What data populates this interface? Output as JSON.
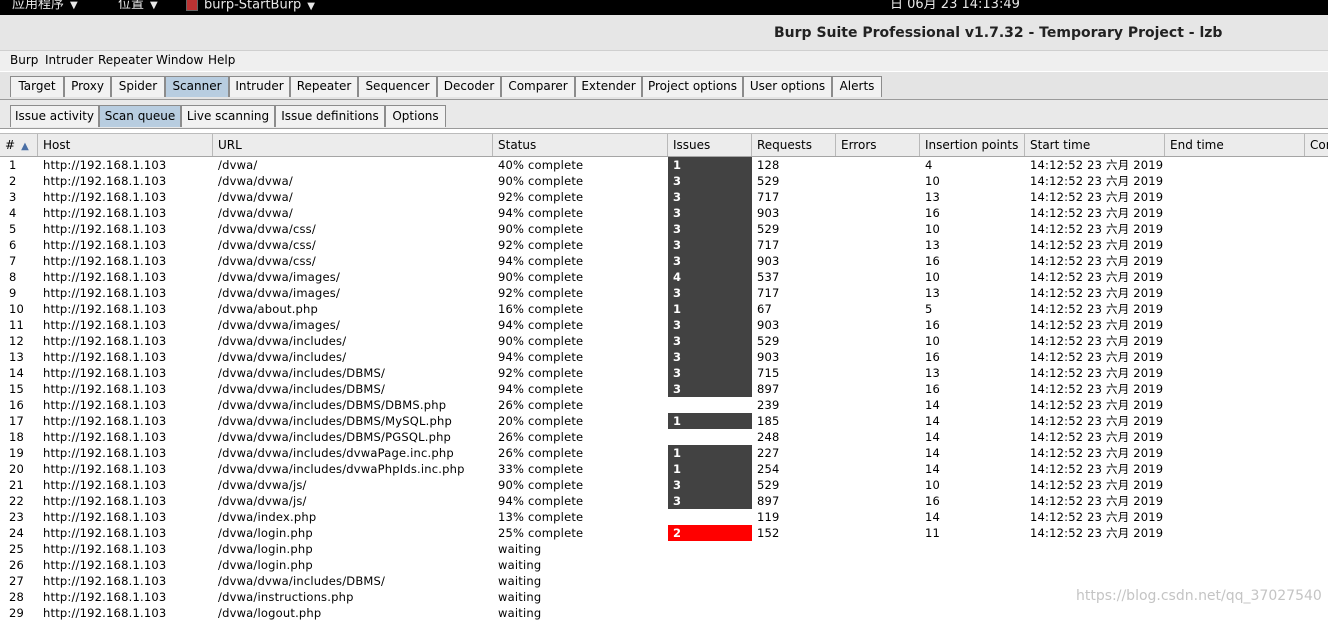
{
  "system_bar": {
    "apps": "应用程序",
    "places": "位置",
    "window_app": "burp-StartBurp",
    "clock": "日 06月 23  14:13:49"
  },
  "window": {
    "title": "Burp Suite Professional v1.7.32 - Temporary Project - lzb"
  },
  "menu": [
    "Burp",
    "Intruder",
    "Repeater",
    "Window",
    "Help"
  ],
  "main_tabs": [
    "Target",
    "Proxy",
    "Spider",
    "Scanner",
    "Intruder",
    "Repeater",
    "Sequencer",
    "Decoder",
    "Comparer",
    "Extender",
    "Project options",
    "User options",
    "Alerts"
  ],
  "main_tab_active": "Scanner",
  "sub_tabs": [
    "Issue activity",
    "Scan queue",
    "Live scanning",
    "Issue definitions",
    "Options"
  ],
  "sub_tab_active": "Scan queue",
  "columns": [
    "#",
    "Host",
    "URL",
    "Status",
    "Issues",
    "Requests",
    "Errors",
    "Insertion points",
    "Start time",
    "End time",
    "Cor"
  ],
  "rows": [
    {
      "n": "1",
      "host": "http://192.168.1.103",
      "url": "/dvwa/",
      "status": "40% complete",
      "issues": "1",
      "sev": "dark",
      "requests": "128",
      "errors": "",
      "ins": "4",
      "start": "14:12:52 23 六月 2019"
    },
    {
      "n": "2",
      "host": "http://192.168.1.103",
      "url": "/dvwa/dvwa/",
      "status": "90% complete",
      "issues": "3",
      "sev": "dark",
      "requests": "529",
      "errors": "",
      "ins": "10",
      "start": "14:12:52 23 六月 2019"
    },
    {
      "n": "3",
      "host": "http://192.168.1.103",
      "url": "/dvwa/dvwa/",
      "status": "92% complete",
      "issues": "3",
      "sev": "dark",
      "requests": "717",
      "errors": "",
      "ins": "13",
      "start": "14:12:52 23 六月 2019"
    },
    {
      "n": "4",
      "host": "http://192.168.1.103",
      "url": "/dvwa/dvwa/",
      "status": "94% complete",
      "issues": "3",
      "sev": "dark",
      "requests": "903",
      "errors": "",
      "ins": "16",
      "start": "14:12:52 23 六月 2019"
    },
    {
      "n": "5",
      "host": "http://192.168.1.103",
      "url": "/dvwa/dvwa/css/",
      "status": "90% complete",
      "issues": "3",
      "sev": "dark",
      "requests": "529",
      "errors": "",
      "ins": "10",
      "start": "14:12:52 23 六月 2019"
    },
    {
      "n": "6",
      "host": "http://192.168.1.103",
      "url": "/dvwa/dvwa/css/",
      "status": "92% complete",
      "issues": "3",
      "sev": "dark",
      "requests": "717",
      "errors": "",
      "ins": "13",
      "start": "14:12:52 23 六月 2019"
    },
    {
      "n": "7",
      "host": "http://192.168.1.103",
      "url": "/dvwa/dvwa/css/",
      "status": "94% complete",
      "issues": "3",
      "sev": "dark",
      "requests": "903",
      "errors": "",
      "ins": "16",
      "start": "14:12:52 23 六月 2019"
    },
    {
      "n": "8",
      "host": "http://192.168.1.103",
      "url": "/dvwa/dvwa/images/",
      "status": "90% complete",
      "issues": "4",
      "sev": "dark",
      "requests": "537",
      "errors": "",
      "ins": "10",
      "start": "14:12:52 23 六月 2019"
    },
    {
      "n": "9",
      "host": "http://192.168.1.103",
      "url": "/dvwa/dvwa/images/",
      "status": "92% complete",
      "issues": "3",
      "sev": "dark",
      "requests": "717",
      "errors": "",
      "ins": "13",
      "start": "14:12:52 23 六月 2019"
    },
    {
      "n": "10",
      "host": "http://192.168.1.103",
      "url": "/dvwa/about.php",
      "status": "16% complete",
      "issues": "1",
      "sev": "dark",
      "requests": "67",
      "errors": "",
      "ins": "5",
      "start": "14:12:52 23 六月 2019"
    },
    {
      "n": "11",
      "host": "http://192.168.1.103",
      "url": "/dvwa/dvwa/images/",
      "status": "94% complete",
      "issues": "3",
      "sev": "dark",
      "requests": "903",
      "errors": "",
      "ins": "16",
      "start": "14:12:52 23 六月 2019"
    },
    {
      "n": "12",
      "host": "http://192.168.1.103",
      "url": "/dvwa/dvwa/includes/",
      "status": "90% complete",
      "issues": "3",
      "sev": "dark",
      "requests": "529",
      "errors": "",
      "ins": "10",
      "start": "14:12:52 23 六月 2019"
    },
    {
      "n": "13",
      "host": "http://192.168.1.103",
      "url": "/dvwa/dvwa/includes/",
      "status": "94% complete",
      "issues": "3",
      "sev": "dark",
      "requests": "903",
      "errors": "",
      "ins": "16",
      "start": "14:12:52 23 六月 2019"
    },
    {
      "n": "14",
      "host": "http://192.168.1.103",
      "url": "/dvwa/dvwa/includes/DBMS/",
      "status": "92% complete",
      "issues": "3",
      "sev": "dark",
      "requests": "715",
      "errors": "",
      "ins": "13",
      "start": "14:12:52 23 六月 2019"
    },
    {
      "n": "15",
      "host": "http://192.168.1.103",
      "url": "/dvwa/dvwa/includes/DBMS/",
      "status": "94% complete",
      "issues": "3",
      "sev": "dark",
      "requests": "897",
      "errors": "",
      "ins": "16",
      "start": "14:12:52 23 六月 2019"
    },
    {
      "n": "16",
      "host": "http://192.168.1.103",
      "url": "/dvwa/dvwa/includes/DBMS/DBMS.php",
      "status": "26% complete",
      "issues": "",
      "sev": "none",
      "requests": "239",
      "errors": "",
      "ins": "14",
      "start": "14:12:52 23 六月 2019"
    },
    {
      "n": "17",
      "host": "http://192.168.1.103",
      "url": "/dvwa/dvwa/includes/DBMS/MySQL.php",
      "status": "20% complete",
      "issues": "1",
      "sev": "dark",
      "requests": "185",
      "errors": "",
      "ins": "14",
      "start": "14:12:52 23 六月 2019"
    },
    {
      "n": "18",
      "host": "http://192.168.1.103",
      "url": "/dvwa/dvwa/includes/DBMS/PGSQL.php",
      "status": "26% complete",
      "issues": "",
      "sev": "none",
      "requests": "248",
      "errors": "",
      "ins": "14",
      "start": "14:12:52 23 六月 2019"
    },
    {
      "n": "19",
      "host": "http://192.168.1.103",
      "url": "/dvwa/dvwa/includes/dvwaPage.inc.php",
      "status": "26% complete",
      "issues": "1",
      "sev": "dark",
      "requests": "227",
      "errors": "",
      "ins": "14",
      "start": "14:12:52 23 六月 2019"
    },
    {
      "n": "20",
      "host": "http://192.168.1.103",
      "url": "/dvwa/dvwa/includes/dvwaPhpIds.inc.php",
      "status": "33% complete",
      "issues": "1",
      "sev": "dark",
      "requests": "254",
      "errors": "",
      "ins": "14",
      "start": "14:12:52 23 六月 2019"
    },
    {
      "n": "21",
      "host": "http://192.168.1.103",
      "url": "/dvwa/dvwa/js/",
      "status": "90% complete",
      "issues": "3",
      "sev": "dark",
      "requests": "529",
      "errors": "",
      "ins": "10",
      "start": "14:12:52 23 六月 2019"
    },
    {
      "n": "22",
      "host": "http://192.168.1.103",
      "url": "/dvwa/dvwa/js/",
      "status": "94% complete",
      "issues": "3",
      "sev": "dark",
      "requests": "897",
      "errors": "",
      "ins": "16",
      "start": "14:12:52 23 六月 2019"
    },
    {
      "n": "23",
      "host": "http://192.168.1.103",
      "url": "/dvwa/index.php",
      "status": "13% complete",
      "issues": "",
      "sev": "none",
      "requests": "119",
      "errors": "",
      "ins": "14",
      "start": "14:12:52 23 六月 2019"
    },
    {
      "n": "24",
      "host": "http://192.168.1.103",
      "url": "/dvwa/login.php",
      "status": "25% complete",
      "issues": "2",
      "sev": "red",
      "requests": "152",
      "errors": "",
      "ins": "11",
      "start": "14:12:52 23 六月 2019"
    },
    {
      "n": "25",
      "host": "http://192.168.1.103",
      "url": "/dvwa/login.php",
      "status": "waiting",
      "issues": "",
      "sev": "none",
      "requests": "",
      "errors": "",
      "ins": "",
      "start": ""
    },
    {
      "n": "26",
      "host": "http://192.168.1.103",
      "url": "/dvwa/login.php",
      "status": "waiting",
      "issues": "",
      "sev": "none",
      "requests": "",
      "errors": "",
      "ins": "",
      "start": ""
    },
    {
      "n": "27",
      "host": "http://192.168.1.103",
      "url": "/dvwa/dvwa/includes/DBMS/",
      "status": "waiting",
      "issues": "",
      "sev": "none",
      "requests": "",
      "errors": "",
      "ins": "",
      "start": ""
    },
    {
      "n": "28",
      "host": "http://192.168.1.103",
      "url": "/dvwa/instructions.php",
      "status": "waiting",
      "issues": "",
      "sev": "none",
      "requests": "",
      "errors": "",
      "ins": "",
      "start": ""
    },
    {
      "n": "29",
      "host": "http://192.168.1.103",
      "url": "/dvwa/logout.php",
      "status": "waiting",
      "issues": "",
      "sev": "none",
      "requests": "",
      "errors": "",
      "ins": "",
      "start": ""
    }
  ],
  "colors": {
    "issue_dark": "#424242",
    "issue_high": "#ff0000",
    "active_tab": "#b8cde0"
  },
  "watermark": "https://blog.csdn.net/qq_37027540"
}
